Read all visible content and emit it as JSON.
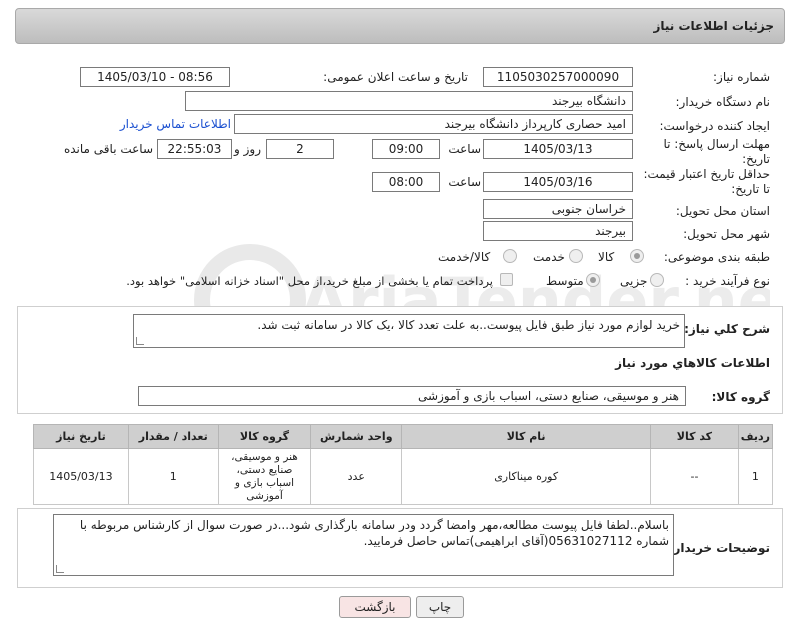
{
  "header": {
    "title": "جزئیات اطلاعات نیاز"
  },
  "fields": {
    "need_number_label": "شماره نیاز:",
    "need_number": "1105030257000090",
    "announce_label": "تاریخ و ساعت اعلان عمومی:",
    "announce_value": "1405/03/10 - 08:56",
    "buyer_label": "نام دستگاه خریدار:",
    "buyer_value": "دانشگاه بیرجند",
    "creator_label": "ایجاد کننده درخواست:",
    "creator_value": "امید حصاری کارپرداز دانشگاه بیرجند",
    "contact_link": "اطلاعات تماس خریدار",
    "deadline_label_1": "مهلت ارسال پاسخ: تا",
    "deadline_label_2": "تاریخ:",
    "deadline_date": "1405/03/13",
    "time_label": "ساعت",
    "deadline_time": "09:00",
    "days_value": "2",
    "days_label": "روز و",
    "remaining_time": "22:55:03",
    "remaining_label": "ساعت باقی مانده",
    "validity_label_1": "حداقل تاریخ اعتبار قیمت:",
    "validity_label_2": "تا تاریخ:",
    "validity_date": "1405/03/16",
    "validity_time": "08:00",
    "province_label": "استان محل تحویل:",
    "province_value": "خراسان جنوبی",
    "city_label": "شهر محل تحویل:",
    "city_value": "بیرجند",
    "category_label": "طبقه بندی موضوعی:",
    "category_options": [
      "کالا",
      "خدمت",
      "کالا/خدمت"
    ],
    "category_selected": "کالا",
    "process_label": "نوع فرآیند خرید :",
    "process_options": [
      "جزیی",
      "متوسط"
    ],
    "process_selected": "متوسط",
    "payment_note": "پرداخت تمام یا بخشی از مبلغ خرید،از محل \"اسناد خزانه اسلامی\" خواهد بود."
  },
  "summary": {
    "label": "شرح کلي نياز:",
    "text": "خرید لوازم مورد نیاز طبق فایل پیوست..به علت تعدد کالا ،یک کالا در سامانه ثبت شد."
  },
  "goods_section": {
    "title": "اطلاعات کالاهاي مورد نياز",
    "group_label": "گروه کالا:",
    "group_value": "هنر و موسیقی، صنایع دستی، اسباب بازی و آموزشی"
  },
  "table": {
    "headers": [
      "ردیف",
      "کد کالا",
      "نام کالا",
      "واحد شمارش",
      "گروه کالا",
      "تعداد / مقدار",
      "تاریخ نیاز"
    ],
    "rows": [
      {
        "row": "1",
        "code": "--",
        "name": "کوره میناکاری",
        "unit": "عدد",
        "group": "هنر و موسیقی، صنایع دستی، اسباب بازی و آموزشی",
        "qty": "1",
        "date": "1405/03/13"
      }
    ]
  },
  "buyer_notes": {
    "label": "توضیحات خریدار:",
    "text": "باسلام..لطفا فایل پیوست مطالعه،مهر وامضا گردد ودر سامانه بارگذاری شود...در صورت سوال از کارشناس مربوطه با شماره 05631027112(آقای ابراهیمی)تماس حاصل فرمایید."
  },
  "buttons": {
    "print": "چاپ",
    "back": "بازگشت"
  },
  "watermark": {
    "text": "AriaTender.net"
  },
  "colors": {
    "link": "#1a4fd0",
    "back_button_bg": "#f8e4e4",
    "print_button_bg": "#eeeeee"
  }
}
